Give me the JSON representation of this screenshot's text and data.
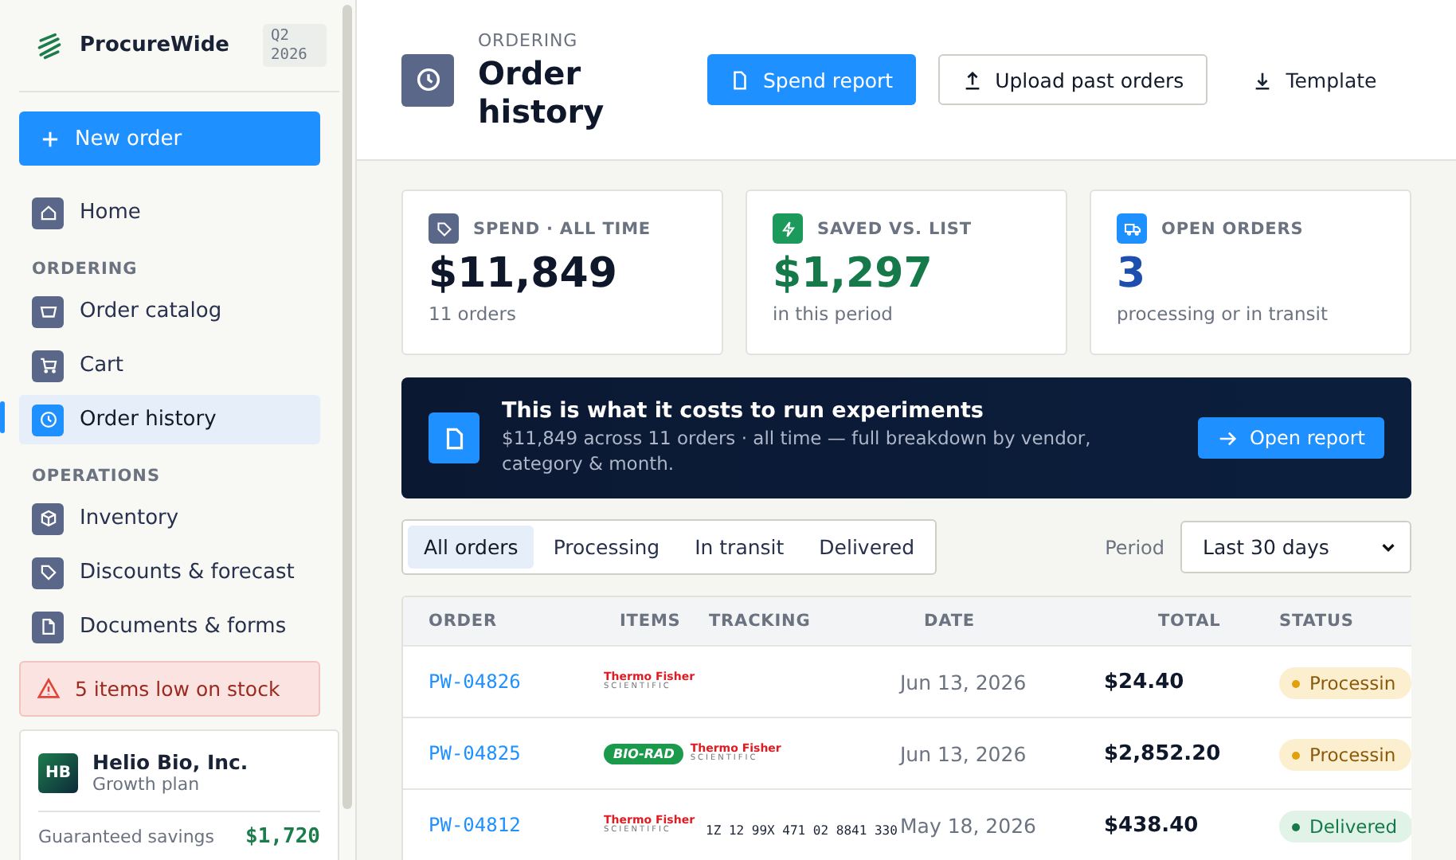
{
  "sidebar": {
    "brand": "ProcureWide",
    "period_badge": "Q2 2026",
    "new_order": "New order",
    "sections": [
      {
        "items": [
          {
            "label": "Home",
            "selected": false
          }
        ]
      },
      {
        "heading": "ORDERING",
        "items": [
          {
            "label": "Order catalog",
            "selected": false
          },
          {
            "label": "Cart",
            "selected": false
          },
          {
            "label": "Order history",
            "selected": true
          }
        ]
      },
      {
        "heading": "OPERATIONS",
        "items": [
          {
            "label": "Inventory",
            "selected": false
          },
          {
            "label": "Discounts & forecast",
            "selected": false
          },
          {
            "label": "Documents & forms",
            "selected": false
          }
        ]
      }
    ],
    "alert": "5 items low on stock",
    "account": {
      "initials": "HB",
      "name": "Helio Bio, Inc.",
      "plan": "Growth plan",
      "savings_label": "Guaranteed savings",
      "savings_value": "$1,720"
    }
  },
  "header": {
    "eyebrow": "ORDERING",
    "title": "Order history",
    "actions": [
      {
        "label": "Spend report",
        "kind": "primary"
      },
      {
        "label": "Upload past orders",
        "kind": "outline"
      },
      {
        "label": "Template",
        "kind": "link"
      }
    ]
  },
  "stats": [
    {
      "label": "SPEND · ALL TIME",
      "value": "$11,849",
      "note": "11 orders",
      "kind": "spend"
    },
    {
      "label": "SAVED VS. LIST",
      "value": "$1,297",
      "note": "in this period",
      "kind": "saved"
    },
    {
      "label": "OPEN ORDERS",
      "value": "3",
      "note": "processing or in transit",
      "kind": "open"
    }
  ],
  "banner": {
    "title": "This is what it costs to run experiments",
    "text": "$11,849 across 11 orders · all time — full breakdown by vendor, category & month.",
    "button": "Open report"
  },
  "filters": {
    "tabs": [
      {
        "label": "All orders",
        "selected": true
      },
      {
        "label": "Processing",
        "selected": false
      },
      {
        "label": "In transit",
        "selected": false
      },
      {
        "label": "Delivered",
        "selected": false
      }
    ],
    "period_label": "Period",
    "period_value": "Last 30 days"
  },
  "table": {
    "columns": [
      "ORDER",
      "ITEMS",
      "TRACKING",
      "DATE",
      "TOTAL",
      "STATUS"
    ],
    "rows": [
      {
        "order": "PW-04826",
        "vendors": [
          {
            "kind": "wordmark",
            "name": "Thermo Fisher",
            "sub": "SCIENTIFIC"
          }
        ],
        "date": "Jun 13, 2026",
        "total": "$24.40",
        "status": {
          "label": "Processin",
          "kind": "processing"
        }
      },
      {
        "order": "PW-04825",
        "vendors": [
          {
            "kind": "oval",
            "name": "BIO-RAD"
          },
          {
            "kind": "wordmark",
            "name": "Thermo Fisher",
            "sub": "SCIENTIFIC"
          }
        ],
        "date": "Jun 13, 2026",
        "total": "$2,852.20",
        "status": {
          "label": "Processin",
          "kind": "processing"
        }
      },
      {
        "order": "PW-04812",
        "vendors": [
          {
            "kind": "wordmark",
            "name": "Thermo Fisher",
            "sub": "SCIENTIFIC"
          }
        ],
        "tracking": "1Z 12 99X 471 02 8841 330",
        "date": "May 18, 2026",
        "total": "$438.40",
        "status": {
          "label": "Delivered",
          "kind": "delivered"
        }
      }
    ]
  }
}
